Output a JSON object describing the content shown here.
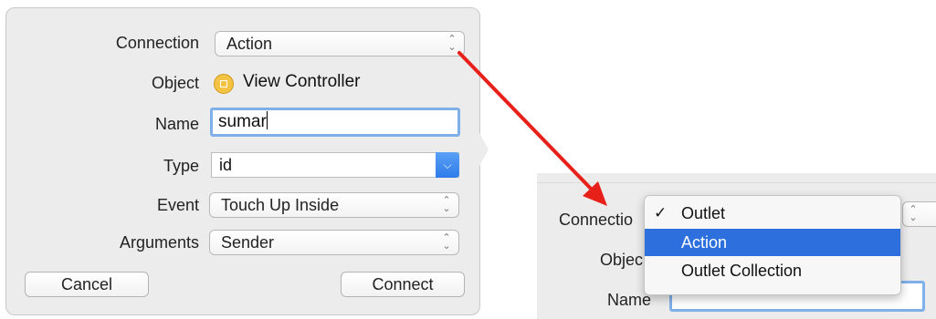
{
  "dialog": {
    "labels": {
      "connection": "Connection",
      "object": "Object",
      "name": "Name",
      "type": "Type",
      "event": "Event",
      "arguments": "Arguments"
    },
    "connection_value": "Action",
    "object_value": "View Controller",
    "name_value": "sumar",
    "type_value": "id",
    "event_value": "Touch Up Inside",
    "arguments_value": "Sender",
    "cancel_label": "Cancel",
    "connect_label": "Connect"
  },
  "crop": {
    "labels": {
      "connection": "Connectio",
      "object": "Objec",
      "name": "Name"
    },
    "menu_items": [
      {
        "label": "Outlet",
        "checked": true,
        "selected": false
      },
      {
        "label": "Action",
        "checked": false,
        "selected": true
      },
      {
        "label": "Outlet Collection",
        "checked": false,
        "selected": false
      }
    ]
  },
  "colors": {
    "arrow": "#e8201a",
    "selection": "#2d6fdc",
    "focus_ring": "#7fb0ea",
    "panel_bg": "#ececec"
  },
  "icons": {
    "check": "✓",
    "stepper": "up-down-chevron-icon",
    "dropdown": "chevron-down-icon",
    "object": "view-controller-icon"
  }
}
